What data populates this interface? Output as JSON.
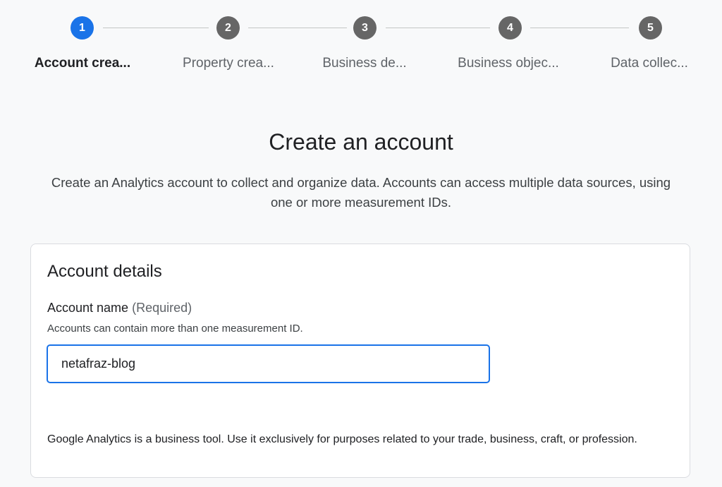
{
  "stepper": {
    "steps": [
      {
        "number": "1",
        "label": "Account crea...",
        "state": "active"
      },
      {
        "number": "2",
        "label": "Property crea...",
        "state": "inactive"
      },
      {
        "number": "3",
        "label": "Business de...",
        "state": "inactive"
      },
      {
        "number": "4",
        "label": "Business objec...",
        "state": "inactive"
      },
      {
        "number": "5",
        "label": "Data collec...",
        "state": "inactive"
      }
    ],
    "colors": {
      "active": "#1a73e8",
      "inactive": "#666666"
    }
  },
  "page": {
    "title": "Create an account",
    "subtitle": "Create an Analytics account to collect and organize data. Accounts can access multiple data sources, using one or more measurement IDs."
  },
  "account_details": {
    "heading": "Account details",
    "field_label": "Account name",
    "field_required": "(Required)",
    "field_help": "Accounts can contain more than one measurement ID.",
    "field_value": "netafraz-blog",
    "disclaimer": "Google Analytics is a business tool. Use it exclusively for purposes related to your trade, business, craft, or profession."
  }
}
